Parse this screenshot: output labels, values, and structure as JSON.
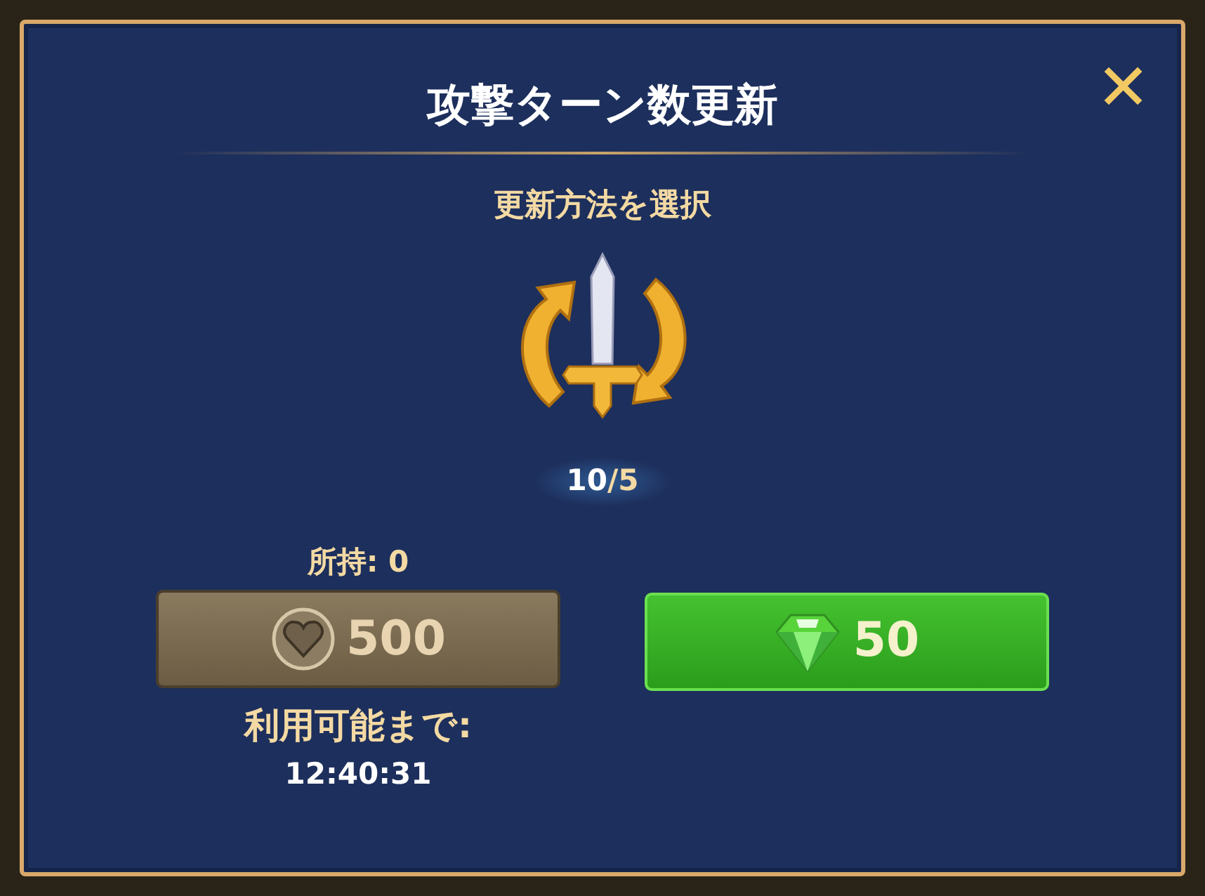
{
  "dialog": {
    "title": "攻撃ターン数更新",
    "close": "✕",
    "subtitle": "更新方法を選択",
    "counter": {
      "current": "10",
      "limit": "/5"
    }
  },
  "options": [
    {
      "kind": "heart",
      "owned": "所持: 0",
      "price": "500",
      "disabled": true,
      "note": "利用可能まで:",
      "timer": "12:40:31"
    },
    {
      "kind": "gem",
      "price": "50",
      "disabled": false
    }
  ]
}
